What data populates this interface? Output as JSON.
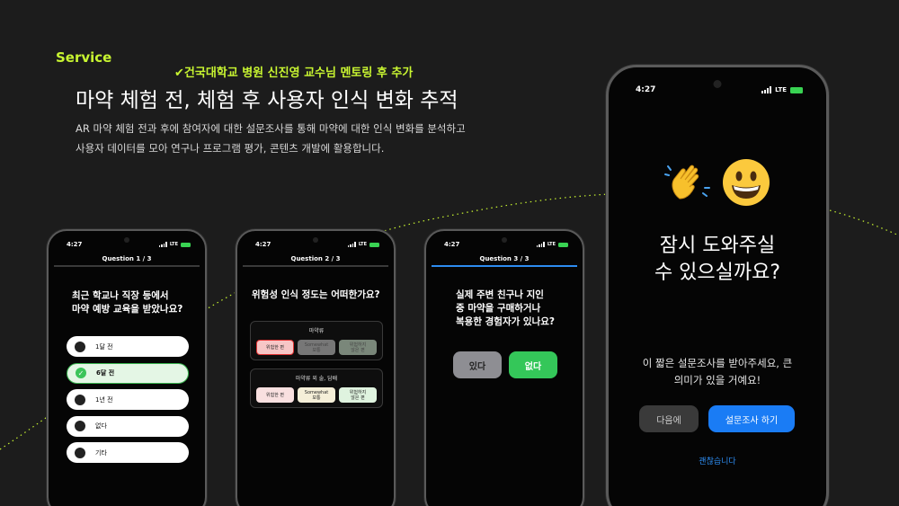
{
  "header": {
    "service_label": "Service",
    "subtitle": "✔건국대학교 병원 신진영 교수님 멘토링 후 추가",
    "title": "마약 체험 전, 체험 후 사용자 인식 변화 추적",
    "desc_line1": "AR 마약 체험 전과 후에 참여자에 대한 설문조사를 통해 마약에 대한 인식 변화를 분석하고",
    "desc_line2": "사용자 데이터를 모아 연구나 프로그램 평가, 콘텐츠 개발에 활용합니다."
  },
  "status": {
    "time": "4:27",
    "network": "LTE"
  },
  "phone1": {
    "header": "Question 1 / 3",
    "question_line1": "최근 학교나 직장 등에서",
    "question_line2": "마약 예방 교육을 받았나요?",
    "options": [
      {
        "label": "1달 전",
        "selected": false
      },
      {
        "label": "6달 전",
        "selected": true
      },
      {
        "label": "1년 전",
        "selected": false
      },
      {
        "label": "없다",
        "selected": false
      },
      {
        "label": "기타",
        "selected": false
      }
    ]
  },
  "phone2": {
    "header": "Question 2 / 3",
    "question": "위험성 인식 정도는 어떠한가요?",
    "group1": {
      "title": "마약류",
      "chip1": "위험한 편",
      "chip2_line1": "Somewhat",
      "chip2_line2": "보통",
      "chip3_line1": "위험하지",
      "chip3_line2": "않은 편"
    },
    "group2": {
      "title": "마약류 외 술, 담배",
      "chip1": "위험한 편",
      "chip2_line1": "Somewhat",
      "chip2_line2": "보통",
      "chip3_line1": "위험하지",
      "chip3_line2": "않은 편"
    }
  },
  "phone3": {
    "header": "Question 3 / 3",
    "question_line1": "실제 주변 친구나 지인",
    "question_line2": "중 마약을 구매하거나",
    "question_line3": "복용한 경험자가 있나요?",
    "yes_label": "있다",
    "no_label": "없다"
  },
  "phone4": {
    "title_line1": "잠시 도와주실",
    "title_line2": "수 있으실까요?",
    "desc_line1": "이 짧은 설문조사를 받아주세요, 큰",
    "desc_line2": "의미가 있을 거예요!",
    "later_label": "다음에",
    "survey_label": "설문조사 하기",
    "okay_label": "괜찮습니다",
    "emoji_icons": [
      "waving-hand-icon",
      "grinning-face-icon"
    ]
  },
  "colors": {
    "accent": "#c8f531",
    "blue": "#1a7cf5",
    "green": "#34c759",
    "background": "#1c1c1c"
  }
}
